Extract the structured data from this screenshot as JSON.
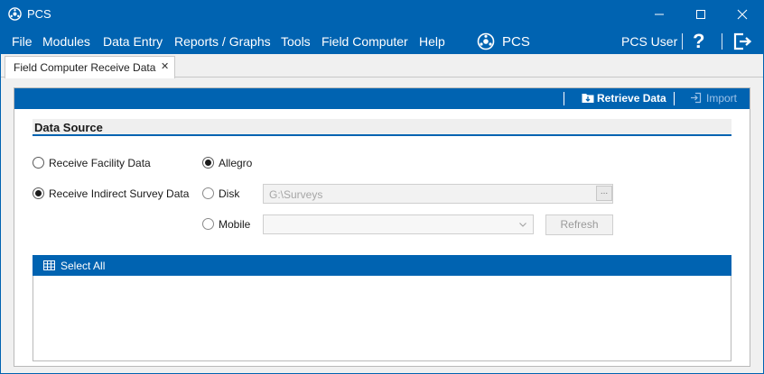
{
  "window": {
    "title": "PCS"
  },
  "menu": {
    "items": [
      "File",
      "Modules",
      "Data Entry",
      "Reports / Graphs",
      "Tools",
      "Field Computer",
      "Help"
    ],
    "brand": "PCS",
    "user": "PCS User"
  },
  "tabs": [
    {
      "label": "Field Computer Receive Data"
    }
  ],
  "toolbar": {
    "retrieve_label": "Retrieve Data",
    "import_label": "Import"
  },
  "data_source": {
    "title": "Data Source",
    "left_options": [
      "Receive Facility Data",
      "Receive Indirect Survey Data"
    ],
    "right_options": [
      "Allegro",
      "Disk",
      "Mobile"
    ],
    "disk_path": "G:\\Surveys",
    "browse_label": "...",
    "refresh_label": "Refresh"
  },
  "grid": {
    "select_all_label": "Select All"
  },
  "colors": {
    "accent": "#0063b1",
    "background": "#f0f0f0"
  }
}
